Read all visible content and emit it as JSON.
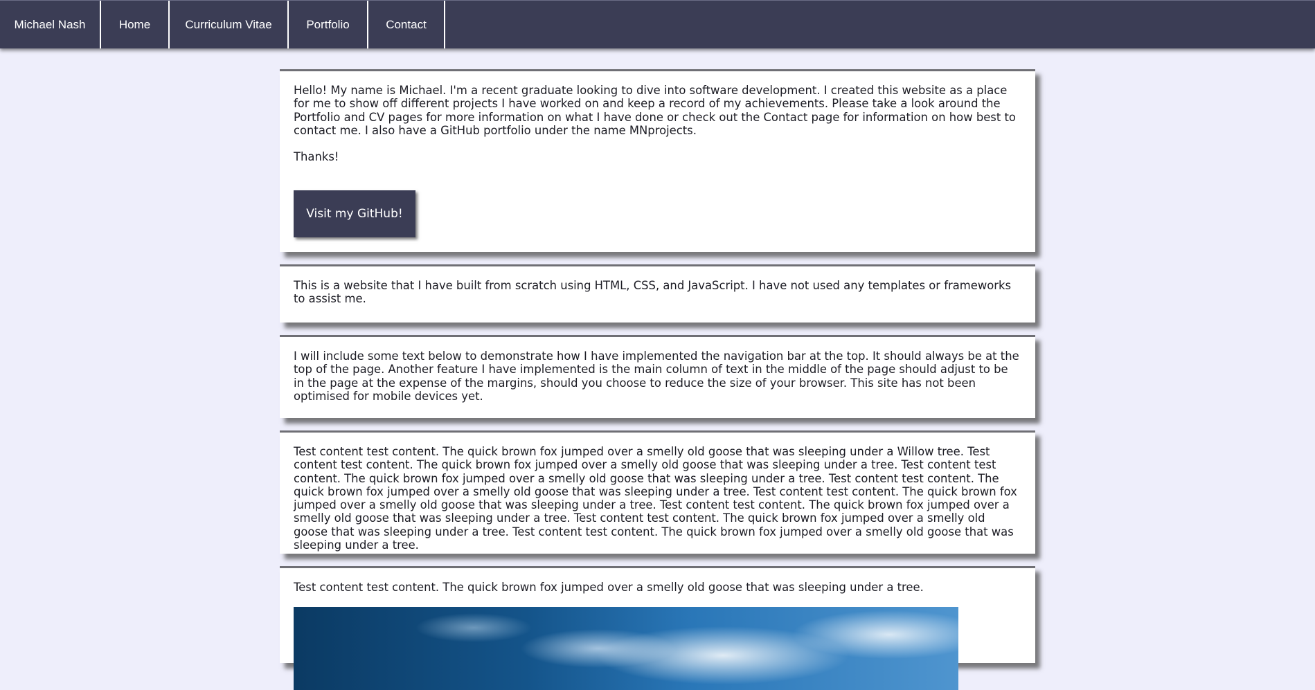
{
  "nav": {
    "brand": "Michael Nash",
    "items": [
      "Home",
      "Curriculum Vitae",
      "Portfolio",
      "Contact"
    ]
  },
  "intro": {
    "para1": "Hello! My name is Michael. I'm a recent graduate looking to dive into software development. I created this website as a place for me to show off different projects I have worked on and keep a record of my achievements. Please take a look around the Portfolio and CV pages for more information on what I have done or check out the Contact page for information on how best to contact me. I also have a GitHub portfolio under the name MNprojects.",
    "para2": "Thanks!",
    "button_label": "Visit my GitHub!"
  },
  "about": {
    "text": "This is a website that I have built from scratch using HTML, CSS, and JavaScript. I have not used any templates or frameworks to assist me."
  },
  "navigation_note": {
    "text": "I will include some text below to demonstrate how I have implemented the navigation bar at the top. It should always be at the top of the page. Another feature I have implemented is the main column of text in the middle of the page should adjust to be in the page at the expense of the margins, should you choose to reduce the size of your browser. This site has not been optimised for mobile devices yet."
  },
  "test_block": {
    "text": "Test content test content. The quick brown fox jumped over a smelly old goose that was sleeping under a Willow tree. Test content test content. The quick brown fox jumped over a smelly old goose that was sleeping under a tree. Test content test content. The quick brown fox jumped over a smelly old goose that was sleeping under a tree. Test content test content. The quick brown fox jumped over a smelly old goose that was sleeping under a tree. Test content test content. The quick brown fox jumped over a smelly old goose that was sleeping under a tree. Test content test content. The quick brown fox jumped over a smelly old goose that was sleeping under a tree. Test content test content. The quick brown fox jumped over a smelly old goose that was sleeping under a tree. Test content test content. The quick brown fox jumped over a smelly old goose that was sleeping under a tree."
  },
  "image_block": {
    "text": "Test content test content. The quick brown fox jumped over a smelly old goose that was sleeping under a tree."
  },
  "colors": {
    "nav_bg": "#3b3d55",
    "page_bg": "#eeeefb",
    "panel_bg": "#ffffff",
    "button_bg": "#3b3d55"
  }
}
